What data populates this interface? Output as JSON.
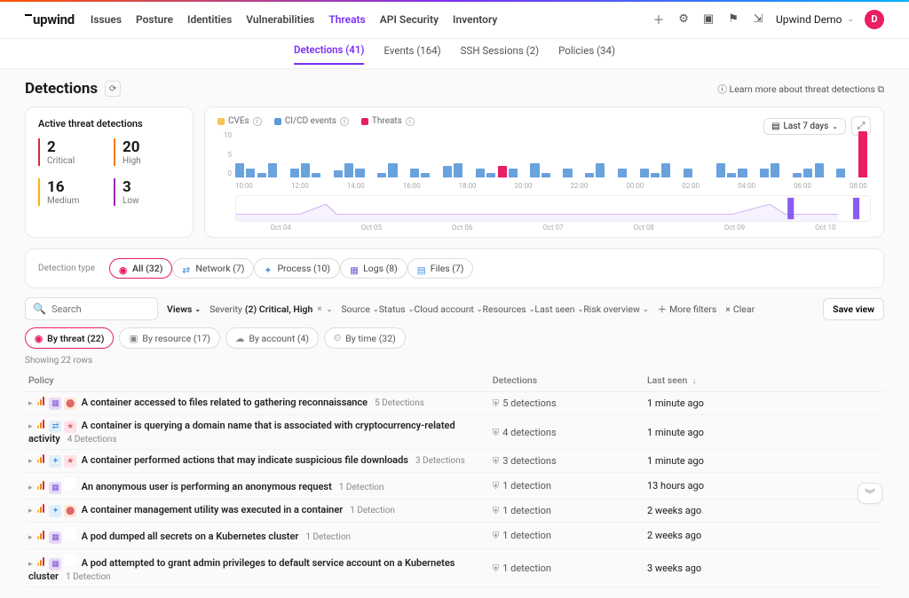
{
  "brand": "upwind",
  "nav": [
    "Issues",
    "Posture",
    "Identities",
    "Vulnerabilities",
    "Threats",
    "API Security",
    "Inventory"
  ],
  "nav_active": "Threats",
  "user": {
    "workspace": "Upwind Demo",
    "initial": "D"
  },
  "subtabs": [
    {
      "label": "Detections (41)",
      "active": true
    },
    {
      "label": "Events (164)"
    },
    {
      "label": "SSH Sessions (2)"
    },
    {
      "label": "Policies (34)"
    }
  ],
  "page_title": "Detections",
  "learn_more": "Learn more about threat detections",
  "stats": {
    "title": "Active threat detections",
    "items": [
      {
        "num": "2",
        "lbl": "Critical",
        "cls": "crit"
      },
      {
        "num": "20",
        "lbl": "High",
        "cls": "high"
      },
      {
        "num": "16",
        "lbl": "Medium",
        "cls": "med"
      },
      {
        "num": "3",
        "lbl": "Low",
        "cls": "low"
      }
    ]
  },
  "chart_legend": [
    {
      "label": "CVEs",
      "color": "#f6c453"
    },
    {
      "label": "CI/CD events",
      "color": "#5a9bd8"
    },
    {
      "label": "Threats",
      "color": "#e91e63"
    }
  ],
  "chart_range": "Last 7 days",
  "chart_data": {
    "type": "bar",
    "ylim": [
      0,
      10
    ],
    "yticks": [
      "10",
      "5",
      "0"
    ],
    "xticks_hours": [
      "10:00",
      "12:00",
      "14:00",
      "16:00",
      "18:00",
      "20:00",
      "22:00",
      "00:00",
      "02:00",
      "04:00",
      "06:00",
      "08:00"
    ],
    "xticks_days": [
      "Oct 04",
      "Oct 05",
      "Oct 06",
      "Oct 07",
      "Oct 08",
      "Oct 09",
      "Oct 10"
    ],
    "series_color_default": "#6aa2de",
    "bars": [
      {
        "h": 3
      },
      {
        "h": 2
      },
      {
        "h": 1
      },
      {
        "h": 3
      },
      {
        "h": 0
      },
      {
        "h": 2
      },
      {
        "h": 3
      },
      {
        "h": 1
      },
      {
        "h": 0
      },
      {
        "h": 1.5
      },
      {
        "h": 3
      },
      {
        "h": 2
      },
      {
        "h": 0
      },
      {
        "h": 1
      },
      {
        "h": 3
      },
      {
        "h": 0
      },
      {
        "h": 2
      },
      {
        "h": 1
      },
      {
        "h": 0
      },
      {
        "h": 2.5
      },
      {
        "h": 3
      },
      {
        "h": 0
      },
      {
        "h": 2
      },
      {
        "h": 1
      },
      {
        "h": 2.5,
        "c": "#e91e63"
      },
      {
        "h": 2
      },
      {
        "h": 0
      },
      {
        "h": 3
      },
      {
        "h": 1
      },
      {
        "h": 0
      },
      {
        "h": 2
      },
      {
        "h": 0
      },
      {
        "h": 1
      },
      {
        "h": 3
      },
      {
        "h": 0
      },
      {
        "h": 2
      },
      {
        "h": 0
      },
      {
        "h": 2
      },
      {
        "h": 1
      },
      {
        "h": 3
      },
      {
        "h": 0
      },
      {
        "h": 2
      },
      {
        "h": 0
      },
      {
        "h": 0
      },
      {
        "h": 3
      },
      {
        "h": 1
      },
      {
        "h": 2
      },
      {
        "h": 0
      },
      {
        "h": 2
      },
      {
        "h": 3
      },
      {
        "h": 0
      },
      {
        "h": 1
      },
      {
        "h": 2
      },
      {
        "h": 3
      },
      {
        "h": 0
      },
      {
        "h": 2
      },
      {
        "h": 0
      },
      {
        "h": 10,
        "c": "#e91e63"
      }
    ]
  },
  "detection_type": {
    "label": "Detection type",
    "items": [
      {
        "icon": "shield",
        "label": "All (32)",
        "color": "#e91e63",
        "active": true
      },
      {
        "icon": "net",
        "label": "Network (7)",
        "color": "#4a90e2"
      },
      {
        "icon": "gear",
        "label": "Process (10)",
        "color": "#4a90e2"
      },
      {
        "icon": "doc",
        "label": "Logs (8)",
        "color": "#7b5cd6"
      },
      {
        "icon": "file",
        "label": "Files (7)",
        "color": "#4a90e2"
      }
    ]
  },
  "search_placeholder": "Search",
  "toolbar": {
    "views": "Views",
    "severity_lbl": "Severity",
    "severity_val": "(2) Critical, High",
    "items": [
      "Source",
      "Status",
      "Cloud account",
      "Resources",
      "Last seen",
      "Risk overview"
    ],
    "more": "More filters",
    "clear": "Clear",
    "save": "Save view"
  },
  "grouping": [
    {
      "icon": "shield",
      "label": "By threat (22)",
      "active": true
    },
    {
      "icon": "cube",
      "label": "By resource (17)"
    },
    {
      "icon": "cloud",
      "label": "By account (4)"
    },
    {
      "icon": "clock",
      "label": "By time (32)"
    }
  ],
  "rows_count": "Showing 22 rows",
  "columns": [
    "Policy",
    "Detections",
    "Last seen"
  ],
  "rows": [
    {
      "sev": "med",
      "cat_bg": "#e8d9f7",
      "cat_color": "#7b5cd6",
      "cat_ico": "▦",
      "src_bg": "#ffe9d6",
      "src_ico": "⬤",
      "name": "A container accessed to files related to gathering reconnaissance",
      "link": "5 Detections",
      "det": "5 detections",
      "seen": "1 minute ago"
    },
    {
      "sev": "med",
      "cat_bg": "#dff0fb",
      "cat_color": "#4a90e2",
      "cat_ico": "⇄",
      "src_bg": "#ffe2e8",
      "src_ico": "★",
      "name": "A container is querying a domain name that is associated with cryptocurrency-related activity",
      "link": "4 Detections",
      "det": "4 detections",
      "seen": "1 minute ago"
    },
    {
      "sev": "med",
      "cat_bg": "#dff0fb",
      "cat_color": "#4a90e2",
      "cat_ico": "✦",
      "src_bg": "#ffe2e8",
      "src_ico": "★",
      "name": "A container performed actions that may indicate suspicious file downloads",
      "link": "3 Detections",
      "det": "3 detections",
      "seen": "1 minute ago"
    },
    {
      "sev": "med",
      "cat_bg": "#e8d9f7",
      "cat_color": "#7b5cd6",
      "cat_ico": "▦",
      "src_bg": "#fff",
      "src_ico": "",
      "name": "An anonymous user is performing an anonymous request",
      "link": "1 Detection",
      "det": "1 detection",
      "seen": "13 hours ago"
    },
    {
      "sev": "med",
      "cat_bg": "#dff0fb",
      "cat_color": "#4a90e2",
      "cat_ico": "✦",
      "src_bg": "#ffe9d6",
      "src_ico": "⬤",
      "name": "A container management utility was executed in a container",
      "link": "1 Detection",
      "det": "1 detection",
      "seen": "2 weeks ago"
    },
    {
      "sev": "med",
      "cat_bg": "#e8d9f7",
      "cat_color": "#7b5cd6",
      "cat_ico": "▦",
      "src_bg": "#fff",
      "src_ico": "",
      "name": "A pod dumped all secrets on a Kubernetes cluster",
      "link": "1 Detection",
      "det": "1 detection",
      "seen": "2 weeks ago"
    },
    {
      "sev": "med",
      "cat_bg": "#e8d9f7",
      "cat_color": "#7b5cd6",
      "cat_ico": "▦",
      "src_bg": "#fff",
      "src_ico": "",
      "name": "A pod attempted to grant admin privileges to default service account on a Kubernetes cluster",
      "link": "1 Detection",
      "det": "1 detection",
      "seen": "3 weeks ago"
    }
  ]
}
